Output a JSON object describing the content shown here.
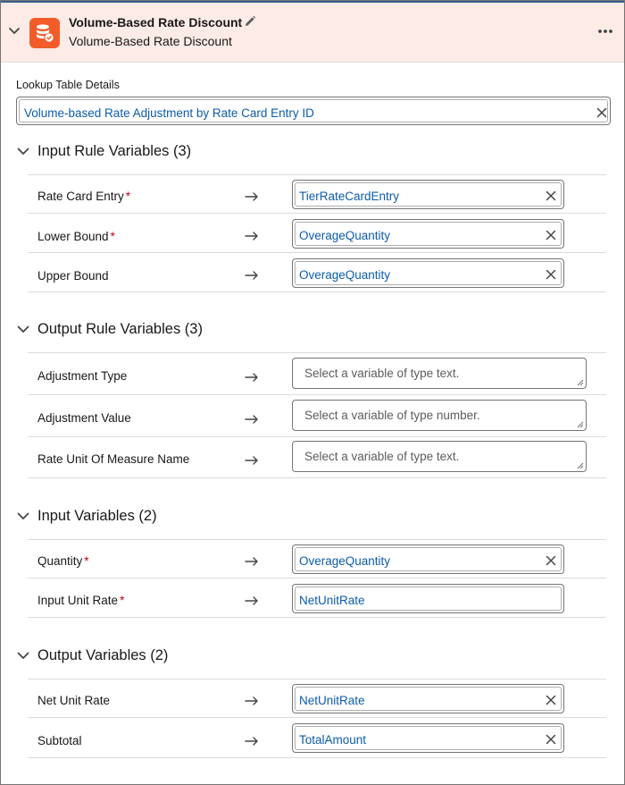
{
  "header": {
    "title": "Volume-Based Rate Discount",
    "subtitle": "Volume-Based Rate Discount",
    "app_icon": "database-icon",
    "edit_icon": "pencil-icon",
    "more_icon": "more-options-icon",
    "accent_color": "#f25c29",
    "background_color": "#fcebe6"
  },
  "lookup": {
    "label": "Lookup Table Details",
    "value": "Volume-based Rate Adjustment by Rate Card Entry ID"
  },
  "input_rule_variables": {
    "title": "Input Rule Variables (3)",
    "rows": [
      {
        "label": "Rate Card Entry",
        "required": "*",
        "value": "TierRateCardEntry"
      },
      {
        "label": "Lower Bound",
        "required": "*",
        "value": "OverageQuantity"
      },
      {
        "label": "Upper Bound",
        "required": "",
        "value": "OverageQuantity"
      }
    ]
  },
  "output_rule_variables": {
    "title": "Output Rule Variables (3)",
    "rows": [
      {
        "label": "Adjustment Type",
        "placeholder": "Select a variable of type text."
      },
      {
        "label": "Adjustment Value",
        "placeholder": "Select a variable of type number."
      },
      {
        "label": "Rate Unit Of Measure Name",
        "placeholder": "Select a variable of type text."
      }
    ]
  },
  "input_variables": {
    "title": "Input Variables (2)",
    "rows": [
      {
        "label": "Quantity",
        "required": "*",
        "value": "OverageQuantity"
      },
      {
        "label": "Input Unit Rate",
        "required": "*",
        "value": "NetUnitRate"
      }
    ]
  },
  "output_variables": {
    "title": "Output Variables (2)",
    "rows": [
      {
        "label": "Net Unit Rate",
        "required": "",
        "value": "NetUnitRate"
      },
      {
        "label": "Subtotal",
        "required": "",
        "value": "TotalAmount"
      }
    ]
  },
  "colors": {
    "link": "#0b5cab",
    "required": "#ba0517",
    "divider": "#dddbda"
  }
}
